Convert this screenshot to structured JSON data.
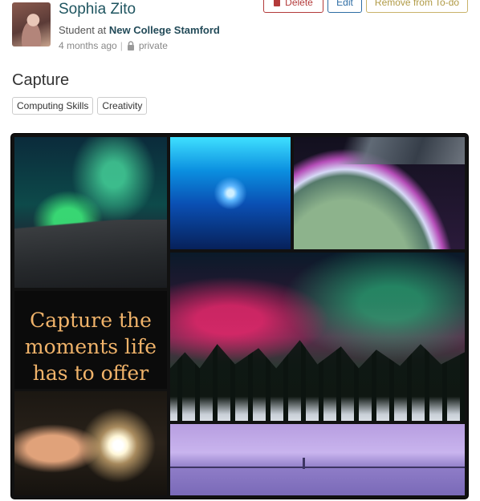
{
  "post": {
    "author": "Sophia Zito",
    "role_prefix": "Student at ",
    "school": "New College Stamford",
    "time": "4 months ago",
    "visibility": "private",
    "title": "Capture",
    "tags": [
      "Computing Skills",
      "Creativity"
    ]
  },
  "actions": {
    "delete_label": "Delete",
    "edit_label": "Edit",
    "remove_label": "Remove from To-do"
  },
  "collage": {
    "quote": "Capture the\nmoments life\nhas to offer"
  },
  "colors": {
    "name": "#1f5560",
    "delete": "#b33a3a",
    "edit": "#2e6da4",
    "remove": "#b09a45",
    "quote": "#f0b36a"
  },
  "icons": [
    "lock-icon",
    "trash-icon"
  ]
}
